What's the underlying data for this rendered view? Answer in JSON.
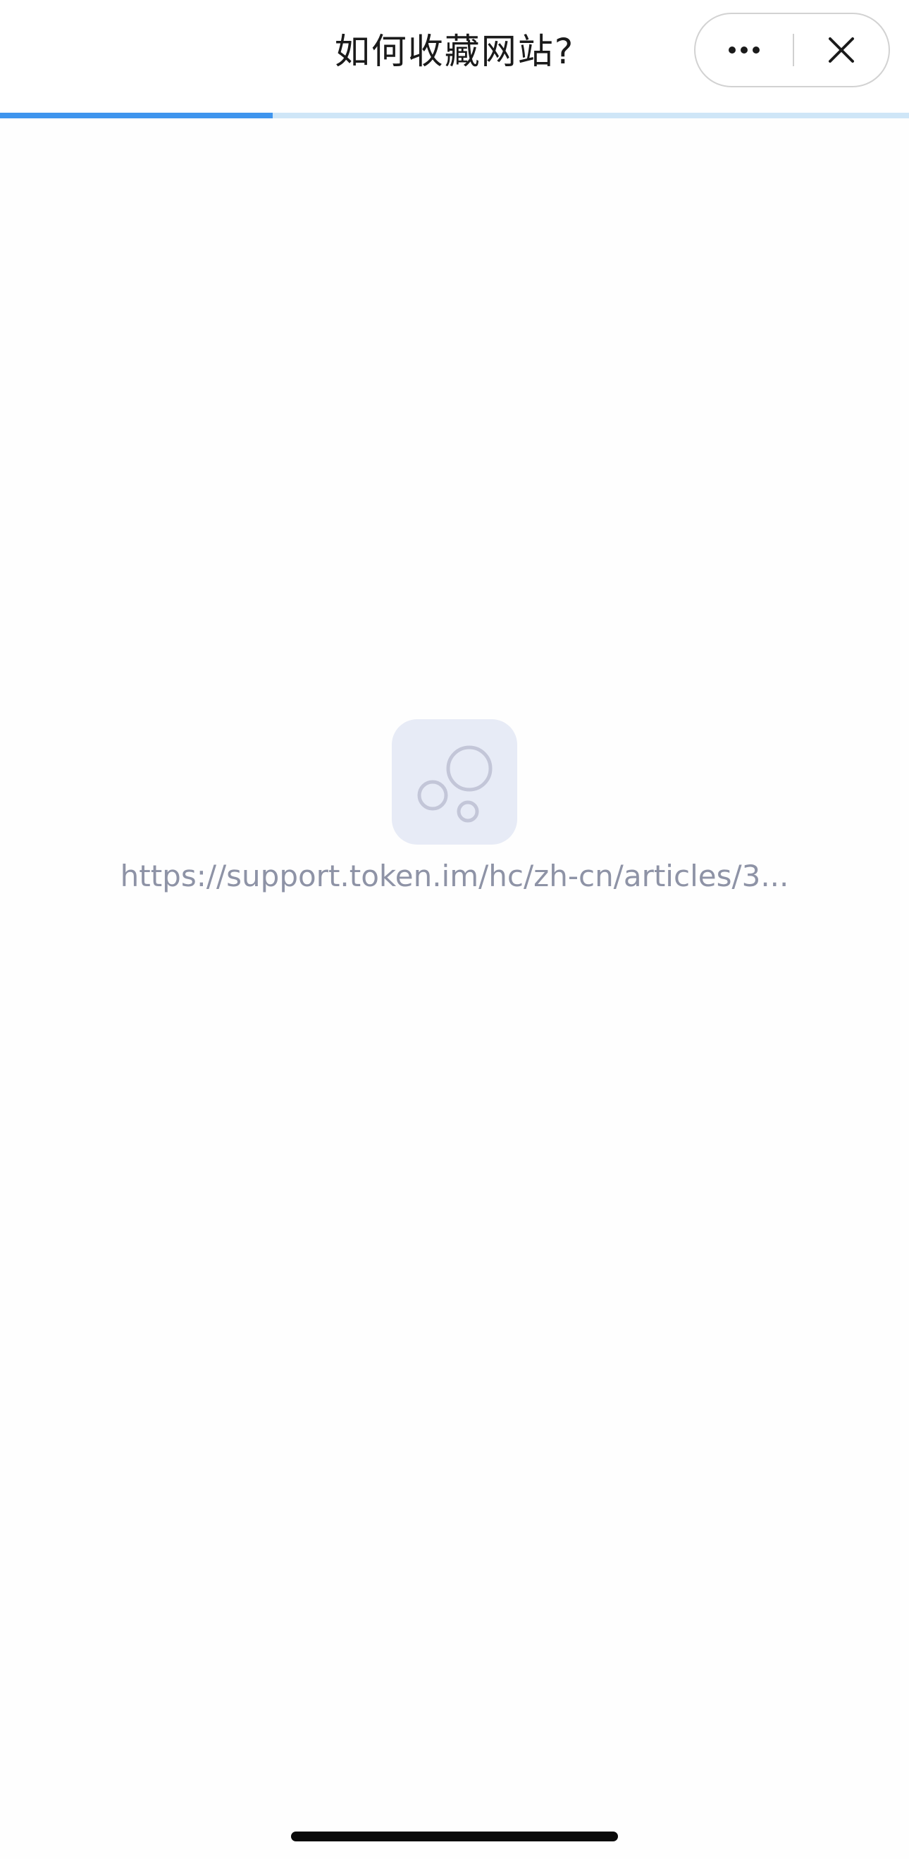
{
  "nav": {
    "title": "如何收藏网站?",
    "more_icon": "more-dots-icon",
    "close_icon": "close-icon"
  },
  "progress": {
    "fraction": 0.3,
    "fill_color": "#3f95ee",
    "track_color": "#cfe6f7"
  },
  "loading": {
    "icon": "bubbles-placeholder-icon",
    "url": "https://support.token.im/hc/zh-cn/articles/3..."
  }
}
